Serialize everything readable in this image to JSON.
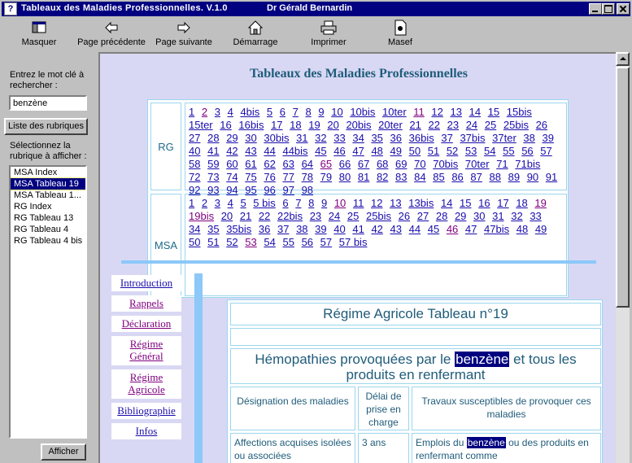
{
  "window": {
    "title": "Tableaux des Maladies Professionnelles.  V.1.0",
    "author": "Dr Gérald Bernardin"
  },
  "toolbar": {
    "masquer": "Masquer",
    "prev": "Page précédente",
    "next": "Page suivante",
    "start": "Démarrage",
    "print": "Imprimer",
    "masef": "Masef"
  },
  "sidebar": {
    "search_label": "Entrez le mot clé à rechercher :",
    "search_value": "benzène",
    "list_button": "Liste des rubriques",
    "select_label": "Sélectionnez la rubrique à afficher :",
    "items": [
      "MSA Index",
      "MSA Tableau 19",
      "MSA Tableau 1...",
      "RG Index",
      "RG Tableau 13",
      "RG Tableau 4",
      "RG Tableau 4 bis"
    ],
    "selected_index": 1,
    "show_button": "Afficher"
  },
  "content": {
    "page_title": "Tableaux des Maladies Professionnelles",
    "rg_label": "RG",
    "rg_links": [
      "1",
      "2",
      "3",
      "4",
      "4bis",
      "5",
      "6",
      "7",
      "8",
      "9",
      "10",
      "10bis",
      "10ter",
      "11",
      "12",
      "13",
      "14",
      "15",
      "15bis",
      "15ter",
      "16",
      "16bis",
      "17",
      "18",
      "19",
      "20",
      "20bis",
      "20ter",
      "21",
      "22",
      "23",
      "24",
      "25",
      "25bis",
      "26",
      "27",
      "28",
      "29",
      "30",
      "30bis",
      "31",
      "32",
      "33",
      "34",
      "35",
      "36",
      "36bis",
      "37",
      "37bis",
      "37ter",
      "38",
      "39",
      "40",
      "41",
      "42",
      "43",
      "44",
      "44bis",
      "45",
      "46",
      "47",
      "48",
      "49",
      "50",
      "51",
      "52",
      "53",
      "54",
      "55",
      "56",
      "57",
      "58",
      "59",
      "60",
      "61",
      "62",
      "63",
      "64",
      "65",
      "66",
      "67",
      "68",
      "69",
      "70",
      "70bis",
      "70ter",
      "71",
      "71bis",
      "72",
      "73",
      "74",
      "75",
      "76",
      "77",
      "78",
      "79",
      "80",
      "81",
      "82",
      "83",
      "84",
      "85",
      "86",
      "87",
      "88",
      "89",
      "90",
      "91",
      "92",
      "93",
      "94",
      "95",
      "96",
      "97",
      "98"
    ],
    "rg_visited": [
      "2",
      "11",
      "65"
    ],
    "msa_label": "MSA",
    "msa_links": [
      "1",
      "2",
      "3",
      "4",
      "5",
      "5 bis",
      "6",
      "7",
      "8",
      "9",
      "10",
      "11",
      "12",
      "13",
      "13bis",
      "14",
      "15",
      "16",
      "17",
      "18",
      "19",
      "19bis",
      "20",
      "21",
      "22",
      "22bis",
      "23",
      "24",
      "25",
      "25bis",
      "26",
      "27",
      "28",
      "29",
      "30",
      "31",
      "32",
      "33",
      "34",
      "35",
      "35bis",
      "36",
      "37",
      "38",
      "39",
      "40",
      "41",
      "42",
      "43",
      "44",
      "45",
      "46",
      "47",
      "47bis",
      "48",
      "49",
      "50",
      "51",
      "52",
      "53",
      "54",
      "55",
      "56",
      "57",
      "57 bis"
    ],
    "msa_visited": [
      "10",
      "19",
      "19bis",
      "46",
      "53"
    ],
    "nav": [
      "Introduction",
      "Rappels",
      "Déclaration",
      "Régime Général",
      "Régime Agricole",
      "Bibliographie",
      "Infos"
    ],
    "doc_title": "Régime Agricole Tableau n°19",
    "doc_sub_before": "Hémopathies provoquées par le",
    "doc_sub_hl": "benzène",
    "doc_sub_after": "et tous les produits en renfermant",
    "col1": "Désignation des maladies",
    "col2": "Délai de prise en charge",
    "col3": "Travaux susceptibles de provoquer ces maladies",
    "cell1": "Affections acquises isolées ou associées",
    "cell2": "3 ans",
    "cell3_before": "Emplois du",
    "cell3_hl": "benzène",
    "cell3_after": "ou des produits en renfermant comme"
  }
}
